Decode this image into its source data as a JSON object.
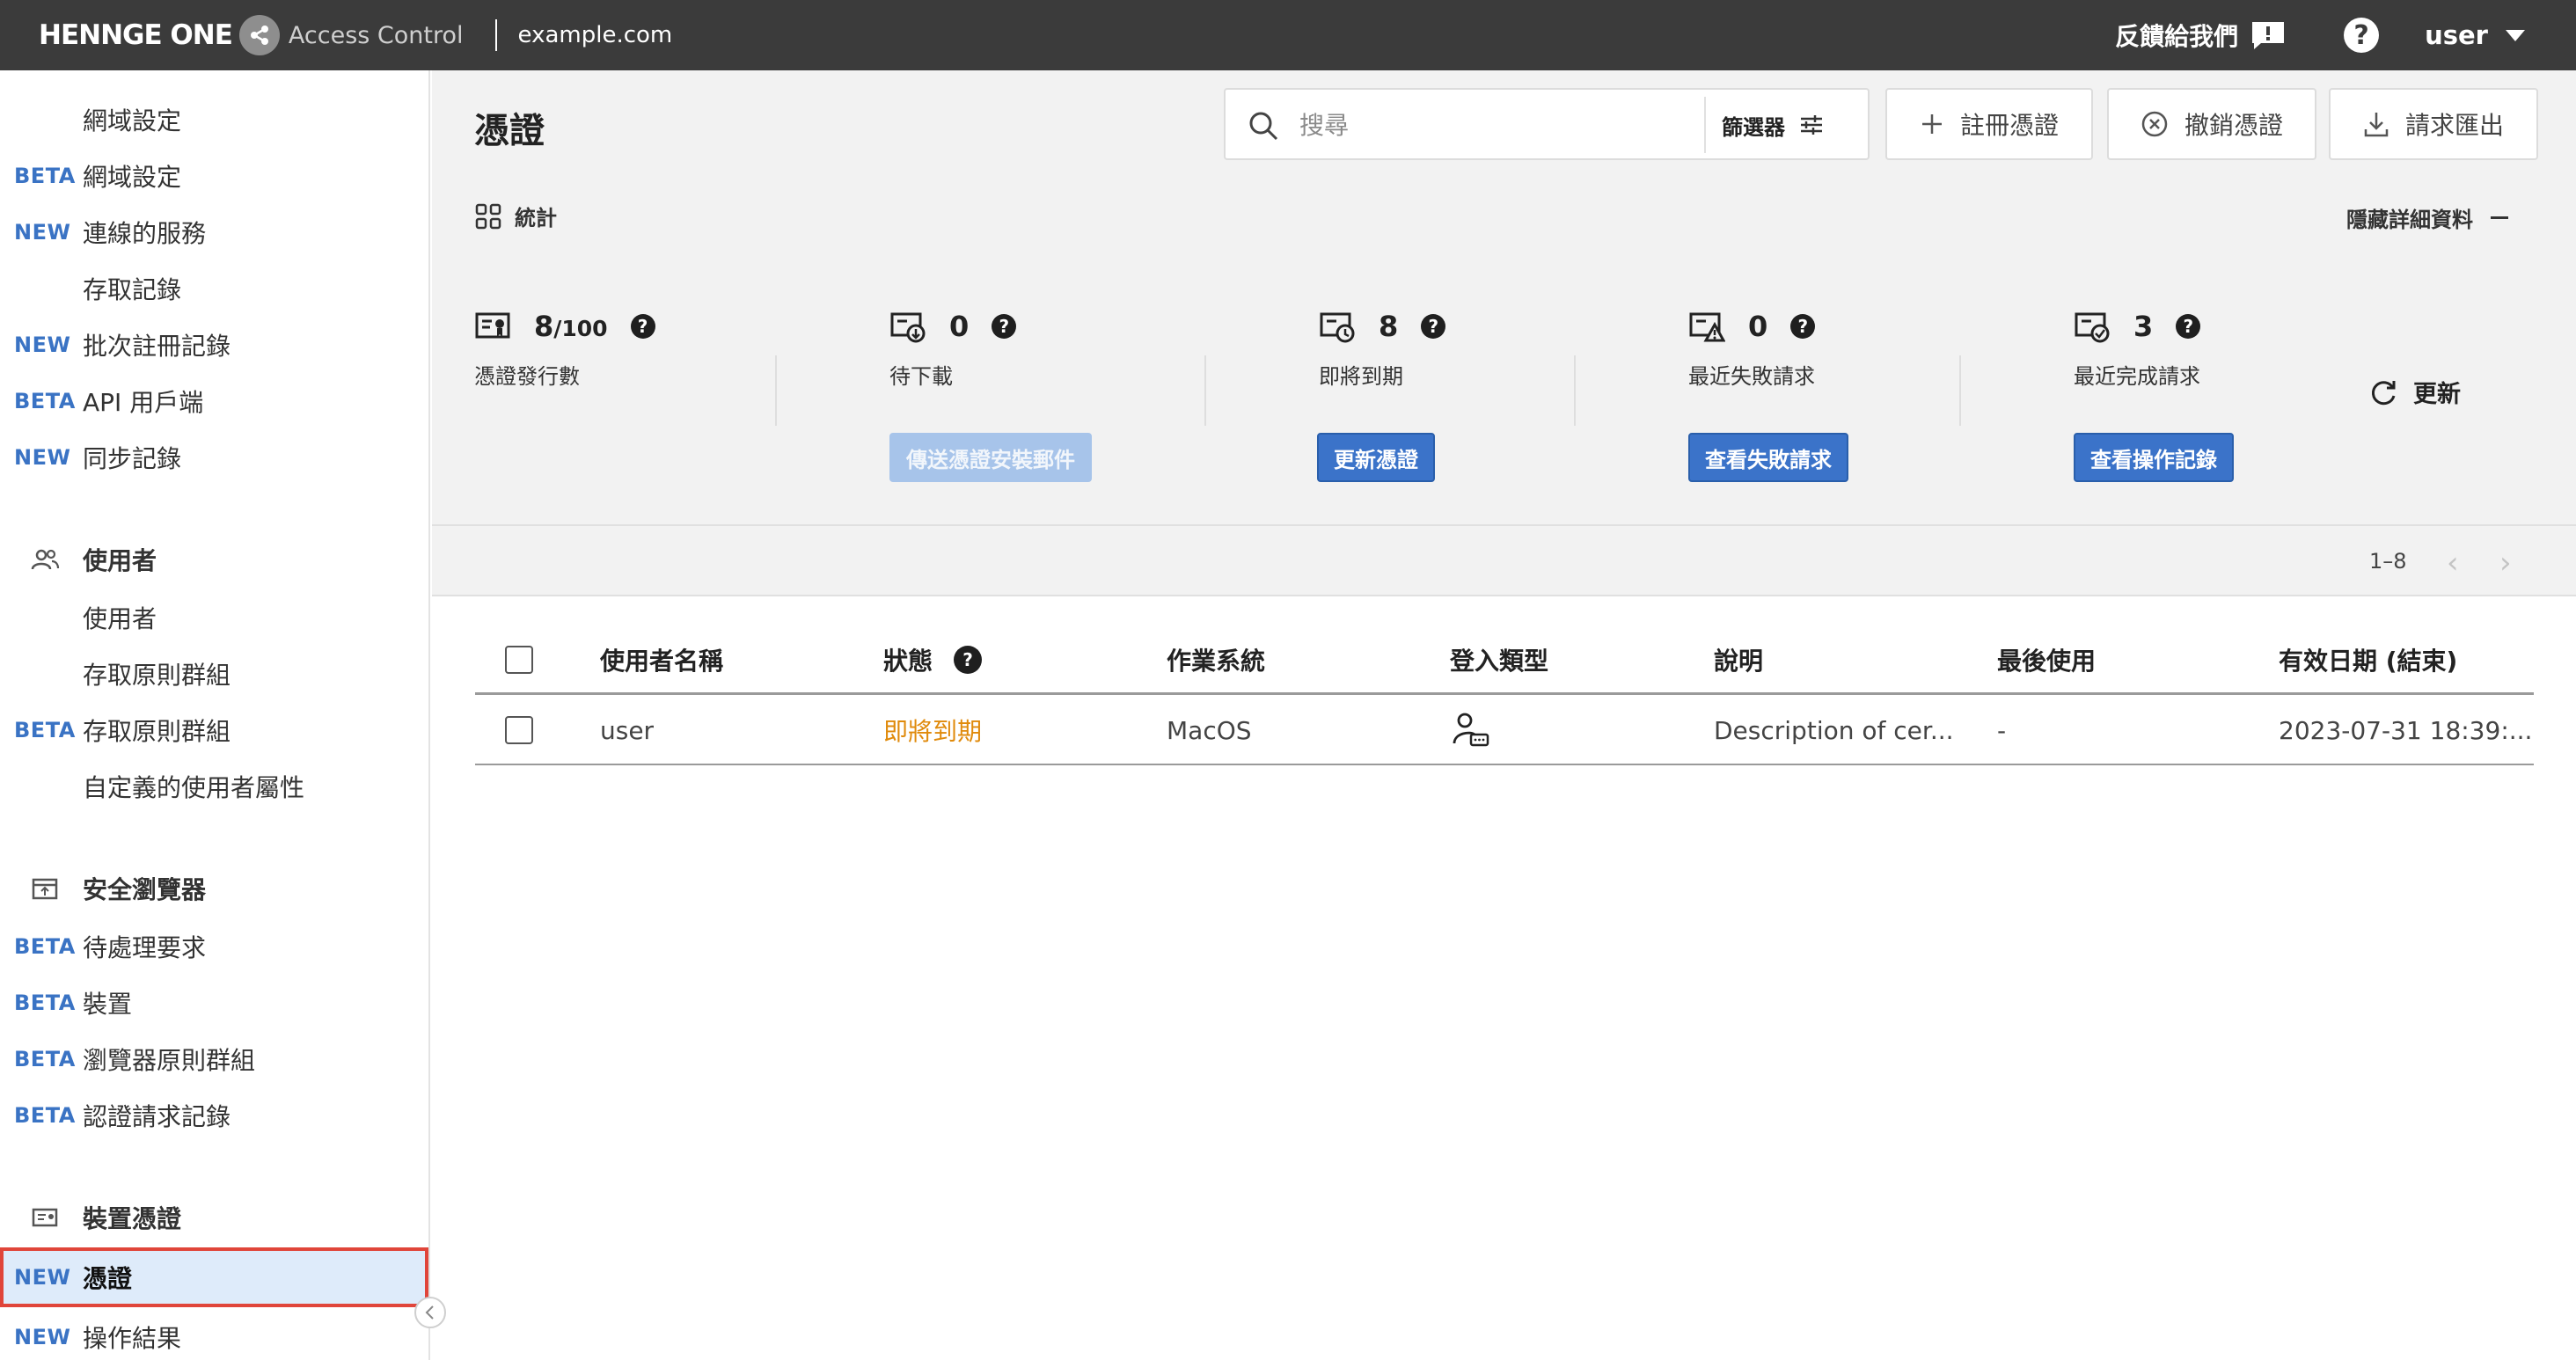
{
  "topbar": {
    "brand": "HENNGE ONE",
    "product": "Access Control",
    "domain": "example.com",
    "feedback": "反饋給我們",
    "user": "user"
  },
  "sidebar": {
    "items": [
      {
        "badge": "",
        "label": "網域設定"
      },
      {
        "badge": "BETA",
        "label": "網域設定"
      },
      {
        "badge": "NEW",
        "label": "連線的服務"
      },
      {
        "badge": "",
        "label": "存取記錄"
      },
      {
        "badge": "NEW",
        "label": "批次註冊記錄"
      },
      {
        "badge": "BETA",
        "label": "API 用戶端"
      },
      {
        "badge": "NEW",
        "label": "同步記錄"
      },
      {
        "group": true,
        "icon": "users-icon",
        "label": "使用者"
      },
      {
        "badge": "",
        "label": "使用者"
      },
      {
        "badge": "",
        "label": "存取原則群組"
      },
      {
        "badge": "BETA",
        "label": "存取原則群組"
      },
      {
        "badge": "",
        "label": "自定義的使用者屬性"
      },
      {
        "group": true,
        "icon": "browser-icon",
        "label": "安全瀏覽器"
      },
      {
        "badge": "BETA",
        "label": "待處理要求"
      },
      {
        "badge": "BETA",
        "label": "裝置"
      },
      {
        "badge": "BETA",
        "label": "瀏覽器原則群組"
      },
      {
        "badge": "BETA",
        "label": "認證請求記錄"
      },
      {
        "group": true,
        "icon": "certificate-icon",
        "label": "裝置憑證"
      },
      {
        "badge": "NEW",
        "label": "憑證",
        "active": true
      },
      {
        "badge": "NEW",
        "label": "操作結果"
      }
    ]
  },
  "main": {
    "title": "憑證",
    "search": {
      "placeholder": "搜尋",
      "value": ""
    },
    "filter_label": "篩選器",
    "buttons": {
      "register": "註冊憑證",
      "revoke": "撤銷憑證",
      "export": "請求匯出"
    },
    "stats_title": "統計",
    "hide_details": "隱藏詳細資料",
    "stats": [
      {
        "value": "8",
        "suffix": "/100",
        "label": "憑證發行數",
        "icon": "certificate-count-icon"
      },
      {
        "value": "0",
        "suffix": "",
        "label": "待下載",
        "icon": "download-pending-icon",
        "action": "傳送憑證安裝郵件"
      },
      {
        "value": "8",
        "suffix": "",
        "label": "即將到期",
        "icon": "expiring-icon",
        "action": "更新憑證"
      },
      {
        "value": "0",
        "suffix": "",
        "label": "最近失敗請求",
        "icon": "failed-request-icon",
        "action": "查看失敗請求"
      },
      {
        "value": "3",
        "suffix": "",
        "label": "最近完成請求",
        "icon": "completed-request-icon",
        "action": "查看操作記錄"
      }
    ],
    "refresh": "更新",
    "pagination": "1–8"
  },
  "table": {
    "columns": [
      "使用者名稱",
      "狀態",
      "作業系統",
      "登入類型",
      "說明",
      "最後使用",
      "有效日期 (結束)"
    ],
    "rows": [
      {
        "user": "user",
        "status": "即將到期",
        "os": "MacOS",
        "login_type": "user-login-icon",
        "description": "Description of cer...",
        "last_used": "-",
        "expires": "2023-07-31 18:39:..."
      }
    ]
  },
  "colors": {
    "topbar": "#3b3b3b",
    "accent": "#3b73c9",
    "badge": "#3a73c4",
    "warning": "#e08a0b",
    "active_bg": "#deebfa",
    "active_border": "#e0453a"
  }
}
